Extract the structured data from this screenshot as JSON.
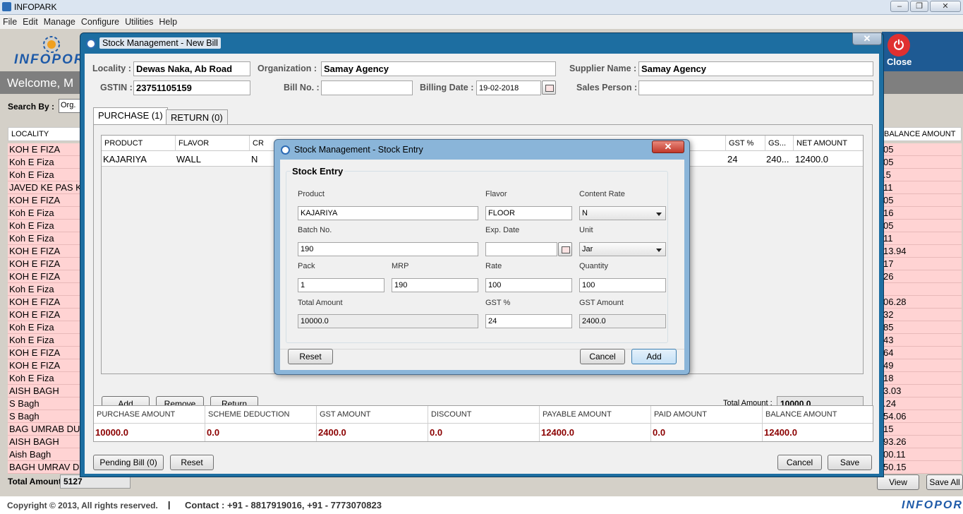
{
  "app": {
    "title": "INFOPARK",
    "window_controls": [
      "‒",
      "❐",
      "✕"
    ]
  },
  "menu": [
    "File",
    "Edit",
    "Manage",
    "Configure",
    "Utilities",
    "Help"
  ],
  "background": {
    "logo_text": "INFOPOR",
    "welcome": "Welcome,  M",
    "close_label": "Close",
    "search_by_label": "Search By :",
    "search_by_value": "Org.",
    "locality_header": "LOCALITY",
    "localities": [
      "KOH E FIZA",
      "Koh E Fiza",
      "Koh E Fiza",
      "JAVED KE PAS K",
      "KOH E FIZA",
      "Koh E Fiza",
      "Koh E Fiza",
      "Koh E Fiza",
      "KOH E FIZA",
      "KOH E FIZA",
      "KOH E FIZA",
      "Koh E Fiza",
      "KOH E FIZA",
      "KOH E FIZA",
      "Koh E Fiza",
      "Koh E Fiza",
      "KOH E FIZA",
      "KOH E FIZA",
      "Koh E Fiza",
      "AISH BAGH",
      "S Bagh",
      "S Bagh",
      "BAG UMRAB DUI",
      "AISH BAGH",
      "Aish Bagh",
      "BAGH UMRAV DI"
    ],
    "balance_header": "BALANCE AMOUNT",
    "balances": [
      "05",
      "05",
      ".5",
      "11",
      "05",
      "16",
      "05",
      "11",
      "13.94",
      "17",
      "26",
      "",
      "06.28",
      "32",
      "85",
      "43",
      "64",
      "49",
      "18",
      "3.03",
      ".24",
      "54.06",
      "15",
      "93.26",
      "00.11",
      "50.15"
    ],
    "total_amount_label": "Total Amount :",
    "total_amount_value": "5127",
    "view_button": "View",
    "save_all_button": "Save All"
  },
  "footer": {
    "copyright": "Copyright © 2013, All rights reserved.",
    "separator": "|",
    "contact": "Contact : +91 - 8817919016, +91 - 7773070823",
    "brand": "INFOPOR"
  },
  "new_bill": {
    "title": "Stock Management - New Bill",
    "close": "✕",
    "locality_label": "Locality :",
    "locality_value": "Dewas Naka, Ab Road",
    "organization_label": "Organization :",
    "organization_value": "Samay Agency",
    "supplier_label": "Supplier Name :",
    "supplier_value": "Samay Agency",
    "gstin_label": "GSTIN :",
    "gstin_value": "23751105159",
    "bill_no_label": "Bill No. :",
    "bill_no_value": "",
    "billing_date_label": "Billing Date :",
    "billing_date_value": "19-02-2018",
    "sales_person_label": "Sales Person :",
    "sales_person_value": "",
    "tabs": [
      "PURCHASE (1)",
      "RETURN (0)"
    ],
    "grid_headers": {
      "product": "PRODUCT",
      "flavor": "FLAVOR",
      "cr": "CR",
      "gst_pct": "GST %",
      "gst_short": "GS...",
      "net_amount": "NET AMOUNT"
    },
    "grid_row": {
      "product": "KAJARIYA",
      "flavor": "WALL",
      "cr": "N",
      "gst_pct": "24",
      "gst_amt": "240...",
      "net_amount": "12400.0"
    },
    "add_button": "Add",
    "remove_button": "Remove",
    "return_button": "Return",
    "total_amount_label": "Total Amount :",
    "total_amount_value": "10000.0",
    "summary_headers": [
      "PURCHASE AMOUNT",
      "SCHEME DEDUCTION",
      "GST AMOUNT",
      "DISCOUNT",
      "PAYABLE AMOUNT",
      "PAID AMOUNT",
      "BALANCE AMOUNT"
    ],
    "summary_values": [
      "10000.0",
      "0.0",
      "2400.0",
      "0.0",
      "12400.0",
      "0.0",
      "12400.0"
    ],
    "pending_bill_button": "Pending Bill (0)",
    "reset_button": "Reset",
    "cancel_button": "Cancel",
    "save_button": "Save"
  },
  "stock_entry": {
    "title": "Stock Management - Stock Entry",
    "group_title": "Stock Entry",
    "product_label": "Product",
    "product_value": "KAJARIYA",
    "flavor_label": "Flavor",
    "flavor_value": "FLOOR",
    "content_rate_label": "Content Rate",
    "content_rate_value": "N",
    "batch_label": "Batch No.",
    "batch_value": "190",
    "exp_date_label": "Exp. Date",
    "exp_date_value": "",
    "unit_label": "Unit",
    "unit_value": "Jar",
    "pack_label": "Pack",
    "pack_value": "1",
    "mrp_label": "MRP",
    "mrp_value": "190",
    "rate_label": "Rate",
    "rate_value": "100",
    "quantity_label": "Quantity",
    "quantity_value": "100",
    "total_amount_label": "Total Amount",
    "total_amount_value": "10000.0",
    "gst_pct_label": "GST %",
    "gst_pct_value": "24",
    "gst_amount_label": "GST Amount",
    "gst_amount_value": "2400.0",
    "reset_button": "Reset",
    "cancel_button": "Cancel",
    "add_button": "Add"
  }
}
